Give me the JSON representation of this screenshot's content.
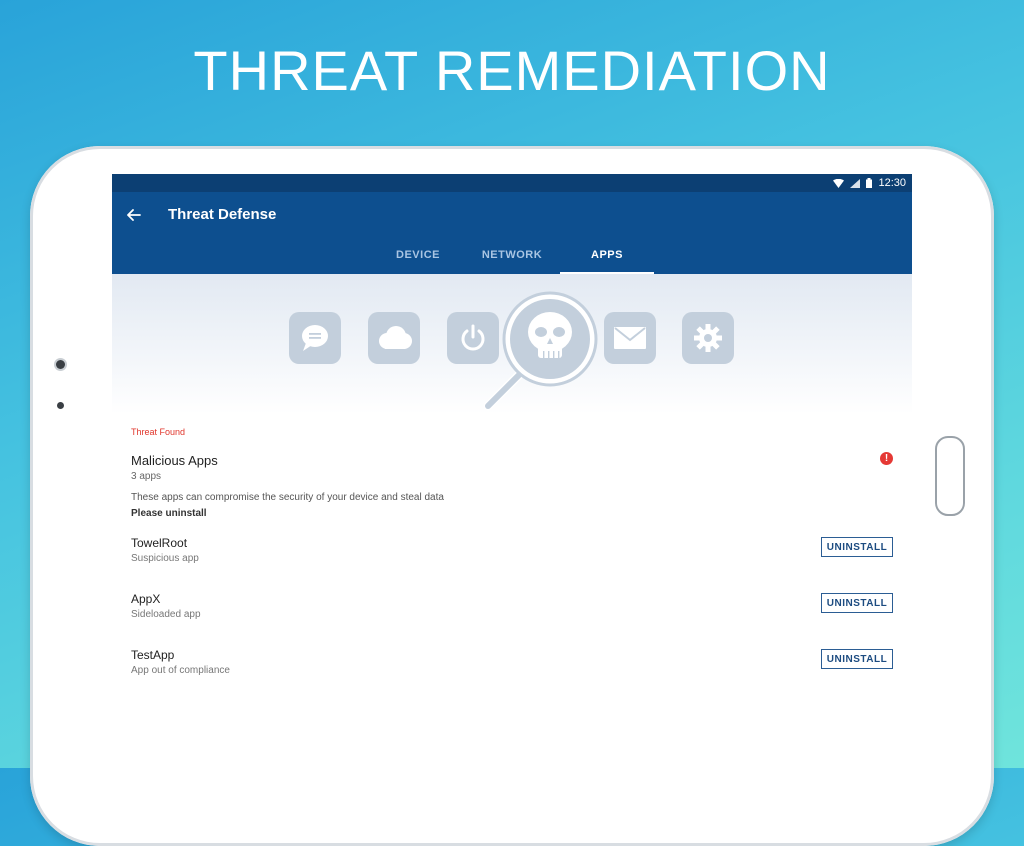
{
  "promo": {
    "title": "THREAT REMEDIATION"
  },
  "status_bar": {
    "time": "12:30"
  },
  "app_bar": {
    "title": "Threat Defense",
    "tabs": [
      {
        "label": "DEVICE"
      },
      {
        "label": "NETWORK"
      },
      {
        "label": "APPS",
        "active": true
      }
    ]
  },
  "hero": {
    "icons": [
      "chat-icon",
      "cloud-icon",
      "power-icon",
      "skull-icon",
      "mail-icon",
      "gear-icon"
    ]
  },
  "threat": {
    "section_label": "Threat Found",
    "title": "Malicious Apps",
    "count": "3 apps",
    "description": "These apps can compromise the security of your device and steal data",
    "instruction": "Please uninstall",
    "alert_glyph": "!"
  },
  "apps": [
    {
      "name": "TowelRoot",
      "subtitle": "Suspicious app",
      "action": "UNINSTALL"
    },
    {
      "name": "AppX",
      "subtitle": "Sideloaded app",
      "action": "UNINSTALL"
    },
    {
      "name": "TestApp",
      "subtitle": "App out of compliance",
      "action": "UNINSTALL"
    }
  ],
  "colors": {
    "app_bar": "#0d4f8f",
    "status_bar": "#0c3f73",
    "threat_red": "#e0352b",
    "button_border": "#2b5d94",
    "hero_icon_bg": "#c3cfdc"
  }
}
